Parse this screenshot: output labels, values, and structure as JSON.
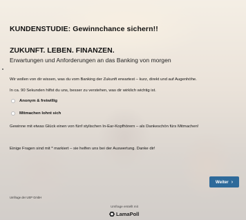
{
  "survey": {
    "title": "KUNDENSTUDIE: Gewinnchance sichern!!",
    "headline": "ZUKUNFT. LEBEN. FINANZEN.",
    "subline": "Erwartungen und Anforderungen an das Banking von morgen",
    "intro": "Wir wollen von dir wissen, was du vom Banking der Zukunft erwartest – kurz, direkt und auf Augenhöhe.",
    "duration": "In ca. 90 Sekunden hilfst du uns, besser zu verstehen, was dir wirklich wichtig ist.",
    "features": [
      "Anonym & freiwillig",
      "Mitmachen lohnt sich"
    ],
    "prize": "Gewinne mit etwas Glück einen von fünf stylischen In-Ear-Kopfhörern – als Dankeschön fürs Mitmachen!",
    "required_note": "Einige Fragen sind mit * markiert – sie helfen uns bei der Auswertung. Danke dir!",
    "next_label": "Weiter",
    "next_icon": "chevron-right-icon"
  },
  "footer": {
    "left": "Umfrage der UEP GmbH",
    "powered_by": "Umfrage erstellt mit",
    "brand": "LamaPoll"
  },
  "colors": {
    "button": "#2e6a9a"
  }
}
